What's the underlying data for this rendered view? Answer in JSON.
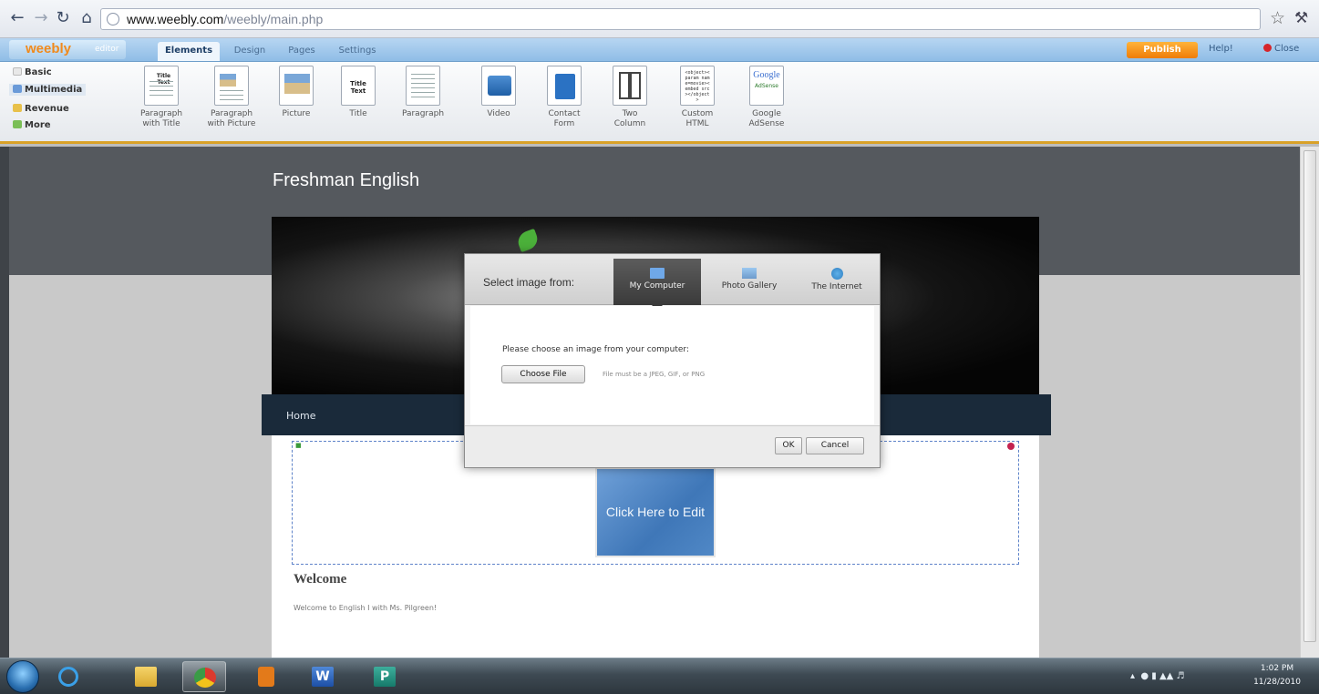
{
  "browser": {
    "url_host": "www.weebly.com",
    "url_path": "/weebly/main.php",
    "icons": [
      "back-arrow-icon",
      "forward-arrow-icon",
      "reload-icon",
      "home-icon",
      "star-icon",
      "wrench-icon"
    ]
  },
  "weebly": {
    "logo": "weebly",
    "logo_suffix": "editor",
    "tabs": [
      "Elements",
      "Design",
      "Pages",
      "Settings"
    ],
    "active_tab": "Elements",
    "publish_label": "Publish",
    "help_label": "Help!",
    "close_label": "Close",
    "accent_color": "#f08a1c"
  },
  "panel": {
    "categories": [
      "Basic",
      "Multimedia",
      "Revenue",
      "More"
    ],
    "elements": [
      {
        "line1": "Paragraph",
        "line2": "with Title"
      },
      {
        "line1": "Paragraph",
        "line2": "with Picture"
      },
      {
        "line1": "Picture",
        "line2": ""
      },
      {
        "line1": "Title",
        "line2": ""
      },
      {
        "line1": "Paragraph",
        "line2": ""
      },
      {
        "line1": "Video",
        "line2": ""
      },
      {
        "line1": "Contact",
        "line2": "Form"
      },
      {
        "line1": "Two",
        "line2": "Column"
      },
      {
        "line1": "Custom",
        "line2": "HTML"
      },
      {
        "line1": "Google",
        "line2": "AdSense"
      }
    ],
    "thumb_title_text": "Title Text",
    "adsense_logo": "Google",
    "adsense_sub": "AdSense"
  },
  "site": {
    "title": "Freshman English",
    "nav_home": "Home",
    "click_edit": "Click Here to Edit",
    "welcome_title": "Welcome",
    "welcome_text": "Welcome to English I with Ms. Pilgreen!"
  },
  "dialog": {
    "select_label": "Select image from:",
    "tabs": [
      "My Computer",
      "Photo Gallery",
      "The Internet"
    ],
    "active_tab": "My Computer",
    "prompt": "Please choose an image from your computer:",
    "choose_file": "Choose File",
    "file_hint": "File must be a JPEG, GIF, or PNG",
    "ok": "OK",
    "cancel": "Cancel"
  },
  "taskbar": {
    "apps": [
      "Internet Explorer",
      "Windows Explorer",
      "Google Chrome",
      "Windows Media Player",
      "Microsoft Word",
      "Microsoft Publisher"
    ],
    "active_app": "Google Chrome",
    "word_letter": "W",
    "publisher_letter": "P",
    "time": "1:02 PM",
    "date": "11/28/2010"
  }
}
